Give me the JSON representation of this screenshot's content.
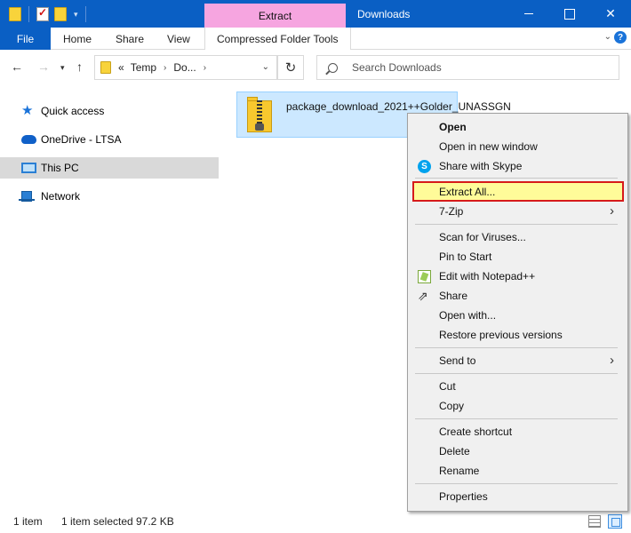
{
  "titlebar": {
    "context_tab": "Extract",
    "window_title": "Downloads"
  },
  "ribbon": {
    "file": "File",
    "home": "Home",
    "share": "Share",
    "view": "View",
    "compressed_tools": "Compressed Folder Tools"
  },
  "navbar": {
    "address_overflow": "«",
    "address_parts": [
      "Temp",
      "Do..."
    ],
    "search_placeholder": "Search Downloads"
  },
  "sidebar": {
    "items": [
      {
        "label": "Quick access",
        "icon": "star-icon"
      },
      {
        "label": "OneDrive - LTSA",
        "icon": "cloud-icon"
      },
      {
        "label": "This PC",
        "icon": "computer-icon",
        "selected": true
      },
      {
        "label": "Network",
        "icon": "network-icon"
      }
    ]
  },
  "file": {
    "name": "package_download_2021++Golder_UNASSGN",
    "icon": "zip-folder-icon"
  },
  "context_menu": {
    "open": "Open",
    "open_new_window": "Open in new window",
    "share_skype": "Share with Skype",
    "extract_all": "Extract All...",
    "seven_zip": "7-Zip",
    "scan": "Scan for Viruses...",
    "pin_start": "Pin to Start",
    "edit_notepad": "Edit with Notepad++",
    "share": "Share",
    "open_with": "Open with...",
    "restore": "Restore previous versions",
    "send_to": "Send to",
    "cut": "Cut",
    "copy": "Copy",
    "create_shortcut": "Create shortcut",
    "delete": "Delete",
    "rename": "Rename",
    "properties": "Properties"
  },
  "status": {
    "item_count": "1 item",
    "selected": "1 item selected",
    "size": "97.2 KB"
  },
  "colors": {
    "titlebar": "#0a5fc4",
    "context_tab": "#f6a5e0",
    "selection": "#cce8ff",
    "highlight": "#fffb99",
    "highlight_border": "#d61a1a"
  }
}
